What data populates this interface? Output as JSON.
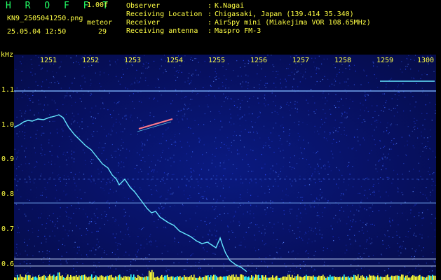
{
  "header": {
    "brand": "H R O F F T",
    "version": "1.00f",
    "filename": "KN9_2505041250.png",
    "mode": "meteor",
    "datetime": "25.05.04 12:50",
    "count": "29"
  },
  "info": [
    {
      "label": "Observer",
      "value": "K.Nagai"
    },
    {
      "label": "Receiving Location",
      "value": "Chigasaki, Japan (139.414 35.340)"
    },
    {
      "label": "Receiver",
      "value": "AirSpy mini (Miakejima VOR 108.65MHz)"
    },
    {
      "label": "Receiving antenna",
      "value": "Maspro FM-3"
    }
  ],
  "axis": {
    "unit": "kHz",
    "y_labels": [
      "1.1",
      "1.0",
      "0.9",
      "0.8",
      "0.7",
      "0.6"
    ],
    "time_labels": [
      "1251",
      "1252",
      "1253",
      "1254",
      "1255",
      "1256",
      "1257",
      "1258",
      "1259",
      "1300"
    ]
  },
  "colors": {
    "background": "#000000",
    "label_text": "#ffff44",
    "brand": "#22ff66",
    "waterfall": "#071060",
    "trace": "#66e8ff",
    "amplitude": "#ffff33"
  }
}
